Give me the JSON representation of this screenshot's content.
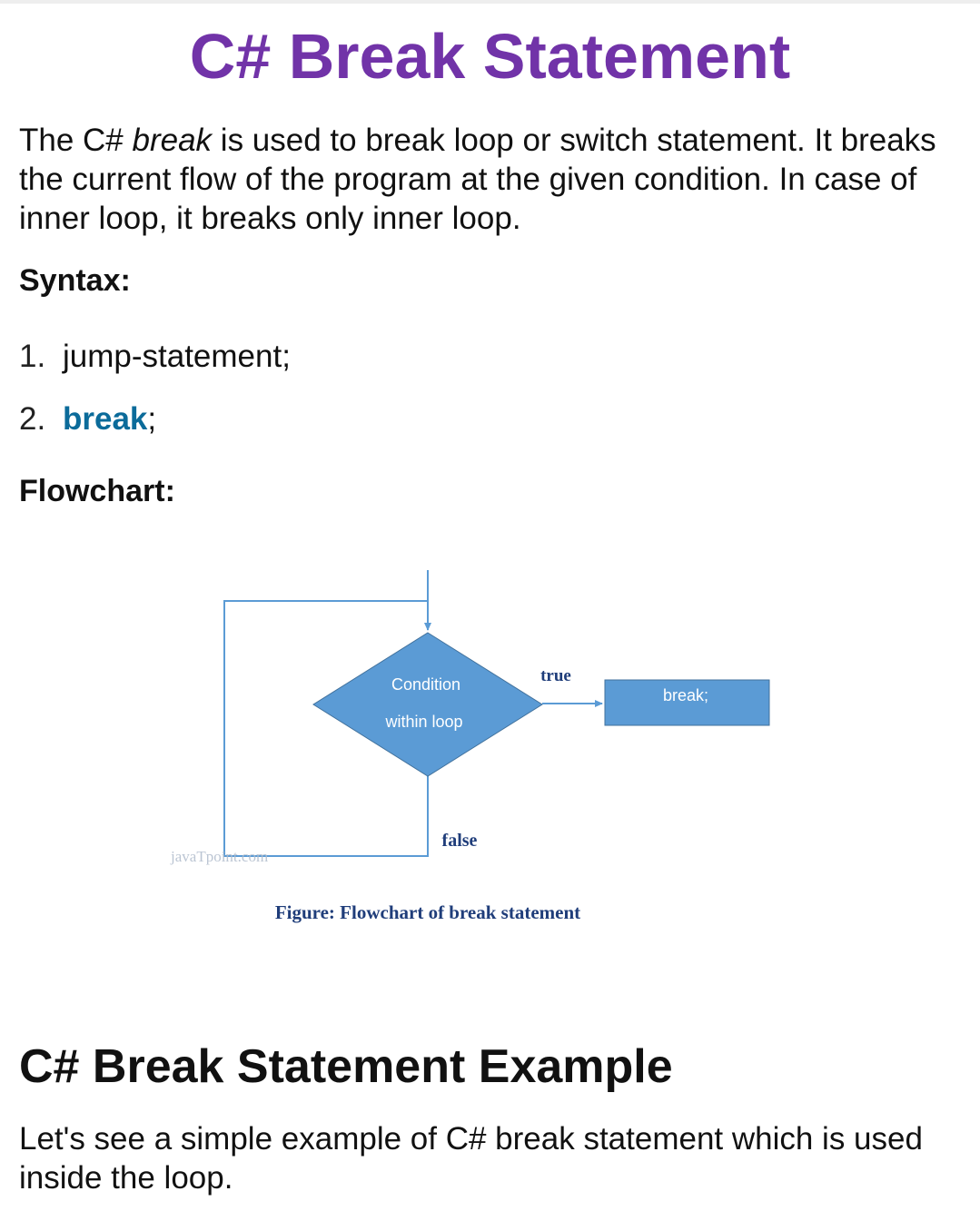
{
  "page": {
    "title": "C# Break Statement",
    "intro": {
      "before": "The C# ",
      "emphasis": "break",
      "after": " is used to break loop or switch statement. It breaks the current flow of the program at the given condition. In case of inner loop, it breaks only inner loop."
    },
    "syntax_heading": "Syntax:",
    "syntax_lines": [
      {
        "num": "1.",
        "text": "jump-statement;"
      },
      {
        "num": "2.",
        "keyword": "break",
        "suffix": ";"
      }
    ],
    "flowchart_heading": "Flowchart:",
    "flowchart": {
      "decision_line1": "Condition",
      "decision_line2": "within loop",
      "true_label": "true",
      "false_label": "false",
      "action_label": "break;",
      "watermark": "javaTpoint.com",
      "caption": "Figure: Flowchart of break statement",
      "colors": {
        "shape_fill": "#5b9bd5",
        "line": "#5b9bd5",
        "label_text": "#1f3d7a"
      }
    },
    "example_heading": "C# Break Statement Example",
    "outro": "Let's see a simple example of C# break statement which is used inside the loop."
  }
}
